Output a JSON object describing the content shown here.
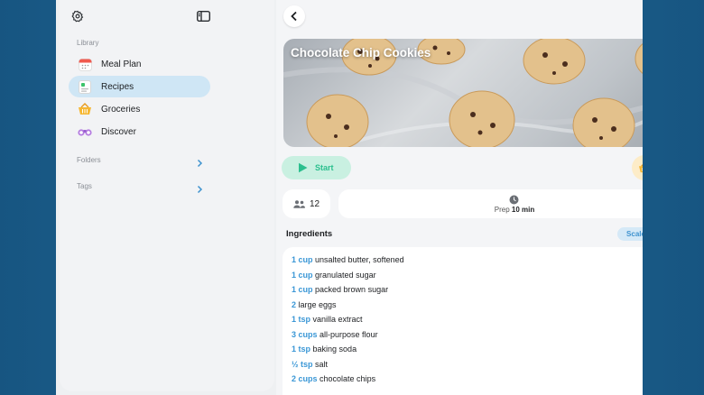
{
  "sidebar": {
    "library_label": "Library",
    "items": [
      {
        "label": "Meal Plan",
        "icon": "calendar-icon"
      },
      {
        "label": "Recipes",
        "icon": "recipes-icon",
        "active": true
      },
      {
        "label": "Groceries",
        "icon": "basket-icon"
      },
      {
        "label": "Discover",
        "icon": "binoculars-icon"
      }
    ],
    "folders_label": "Folders",
    "tags_label": "Tags"
  },
  "recipe": {
    "title": "Chocolate Chip Cookies",
    "start_label": "Start",
    "servings": "12",
    "prep_label": "Prep",
    "prep_time": "10 min"
  },
  "ingredients": {
    "title": "Ingredients",
    "scale_label": "Scale",
    "items": [
      {
        "qty": "1 cup",
        "text": "unsalted butter, softened"
      },
      {
        "qty": "1 cup",
        "text": "granulated sugar"
      },
      {
        "qty": "1 cup",
        "text": "packed brown sugar"
      },
      {
        "qty": "2",
        "text": "large eggs"
      },
      {
        "qty": "1 tsp",
        "text": "vanilla extract"
      },
      {
        "qty": "3 cups",
        "text": "all-purpose flour"
      },
      {
        "qty": "1 tsp",
        "text": "baking soda"
      },
      {
        "qty": "½ tsp",
        "text": "salt"
      },
      {
        "qty": "2 cups",
        "text": "chocolate chips"
      }
    ]
  },
  "colors": {
    "accent": "#3a97d6",
    "start_green": "#2bbf8e",
    "active_nav": "#cfe6f5"
  }
}
